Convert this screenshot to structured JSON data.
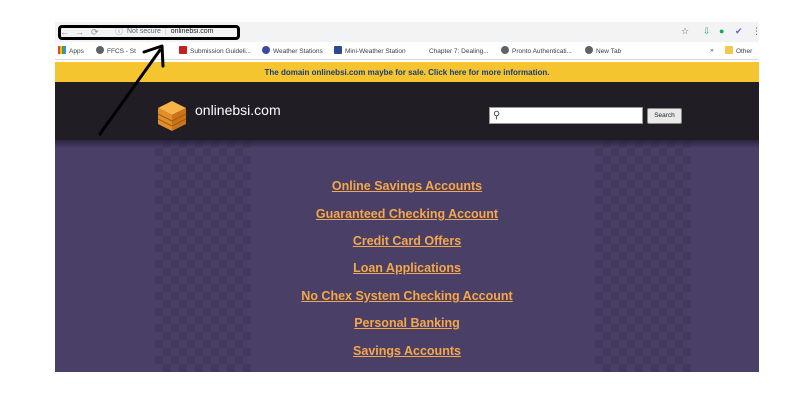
{
  "browser": {
    "security_label": "Not secure",
    "url": "onlinebsi.com",
    "nav_icons": {
      "back": "←",
      "forward": "→",
      "reload": "⟳",
      "info": "ⓘ"
    }
  },
  "bookmarks": {
    "items": [
      {
        "label": "Apps",
        "icon": "apps-grid-icon"
      },
      {
        "label": "FFCS - St",
        "icon": "globe-icon"
      },
      {
        "label": "Submission Guideli...",
        "icon": "pdf-icon"
      },
      {
        "label": "Weather Stations",
        "icon": "weather-icon"
      },
      {
        "label": "Mini-Weather Station",
        "icon": "bookmark-icon"
      },
      {
        "label": "Chapter 7: Dealing...",
        "icon": "page-icon"
      },
      {
        "label": "Pronto Authenticati...",
        "icon": "globe-icon"
      },
      {
        "label": "New Tab",
        "icon": "globe-icon"
      }
    ],
    "overflow": "»",
    "other": "Other"
  },
  "banner": {
    "text": "The domain onlinebsi.com maybe for sale. Click here for more information."
  },
  "header": {
    "logo_text": "onlinebsi.com",
    "search_placeholder": "",
    "search_button": "Search"
  },
  "links": [
    "Online Savings Accounts",
    "Guaranteed Checking Account",
    "Credit Card Offers",
    "Loan Applications",
    "No Chex System Checking Account",
    "Personal Banking",
    "Savings Accounts"
  ],
  "colors": {
    "banner_bg": "#f5c530",
    "banner_text": "#1a3c78",
    "header_bg": "#201d24",
    "main_bg": "#4a3f66",
    "link_color": "#f4a84a"
  }
}
